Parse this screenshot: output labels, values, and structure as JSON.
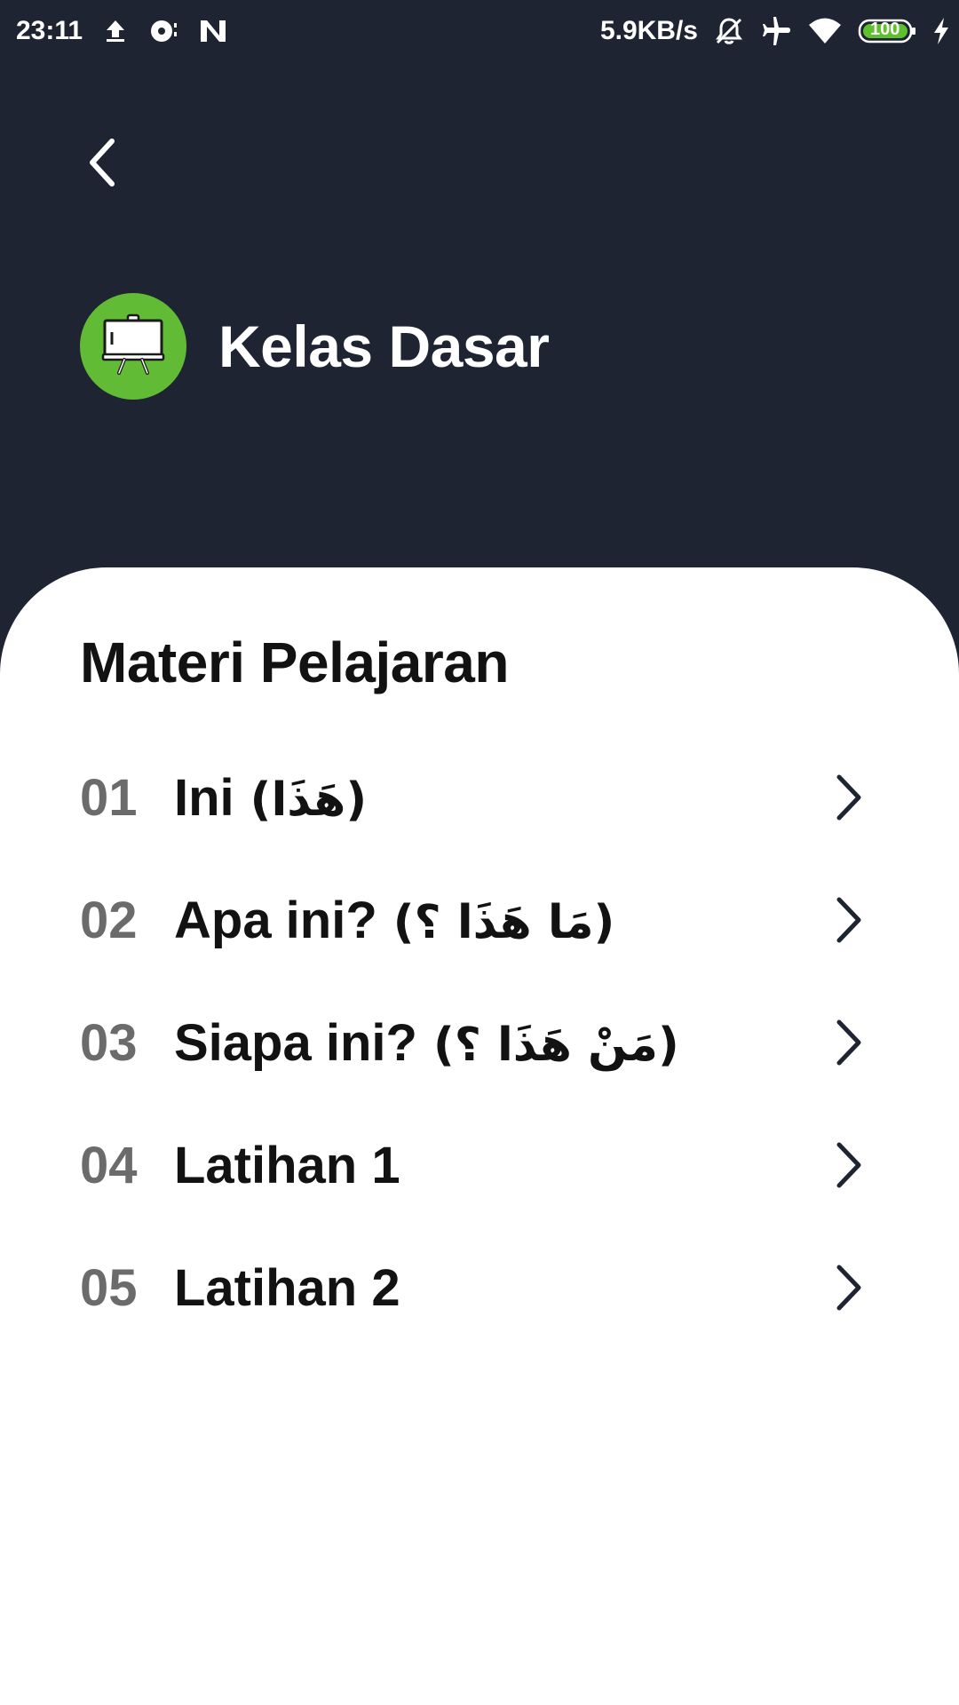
{
  "status_bar": {
    "time": "23:11",
    "net_speed": "5.9KB/s",
    "battery": "100",
    "icons_left": [
      "upload-icon",
      "notification-icon",
      "n-logo-icon"
    ],
    "icons_right": [
      "mute-icon",
      "airplane-icon",
      "wifi-icon",
      "battery-icon",
      "charging-icon"
    ]
  },
  "header": {
    "back_icon": "back-chevron-icon",
    "title": "Kelas Dasar",
    "badge_icon": "whiteboard-easel-icon",
    "badge_color": "#62bb35",
    "background_color": "#1f2433"
  },
  "section": {
    "title": "Materi Pelajaran"
  },
  "lessons": [
    {
      "number": "01",
      "title": "Ini",
      "arabic": "(هَذَا)"
    },
    {
      "number": "02",
      "title": "Apa ini?",
      "arabic": "(مَا هَذَا ؟)"
    },
    {
      "number": "03",
      "title": "Siapa ini?",
      "arabic": "(مَنْ هَذَا ؟)"
    },
    {
      "number": "04",
      "title": "Latihan 1",
      "arabic": ""
    },
    {
      "number": "05",
      "title": "Latihan 2",
      "arabic": ""
    }
  ]
}
